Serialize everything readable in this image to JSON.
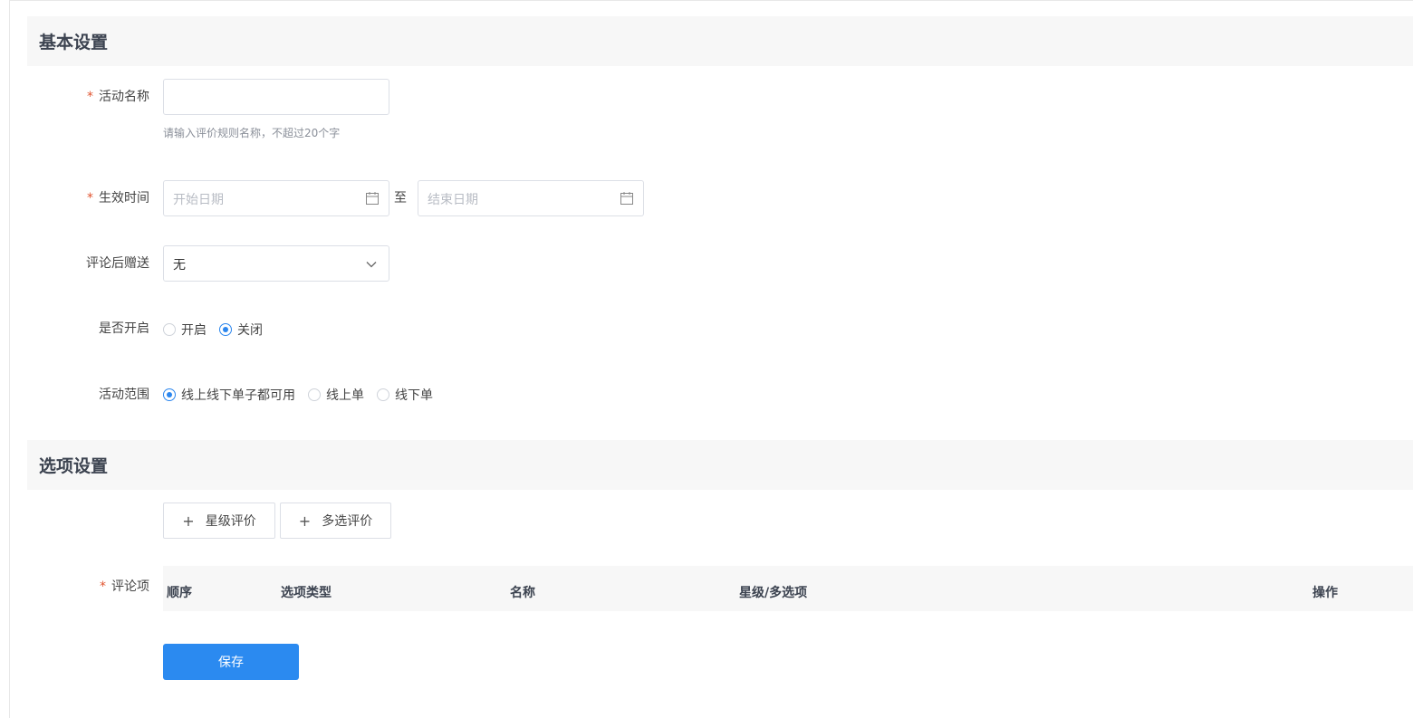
{
  "sections": {
    "basic": "基本设置",
    "options": "选项设置"
  },
  "form": {
    "name": {
      "label": "活动名称",
      "required": true,
      "value": "",
      "hint": "请输入评价规则名称，不超过20个字"
    },
    "effective_time": {
      "label": "生效时间",
      "required": true,
      "start_placeholder": "开始日期",
      "end_placeholder": "结束日期",
      "separator": "至"
    },
    "gift": {
      "label": "评论后赠送",
      "selected": "无"
    },
    "enabled": {
      "label": "是否开启",
      "options": [
        "开启",
        "关闭"
      ],
      "selected": "关闭"
    },
    "scope": {
      "label": "活动范围",
      "options": [
        "线上线下单子都可用",
        "线上单",
        "线下单"
      ],
      "selected": "线上线下单子都可用"
    }
  },
  "options_section": {
    "buttons": [
      "星级评价",
      "多选评价"
    ],
    "comment_items": {
      "label": "评论项",
      "required": true,
      "columns": [
        "顺序",
        "选项类型",
        "名称",
        "星级/多选项",
        "操作"
      ]
    }
  },
  "save_label": "保存",
  "colors": {
    "primary": "#2b8af0",
    "required": "#e1542f",
    "header_bg": "#f7f7f7"
  }
}
